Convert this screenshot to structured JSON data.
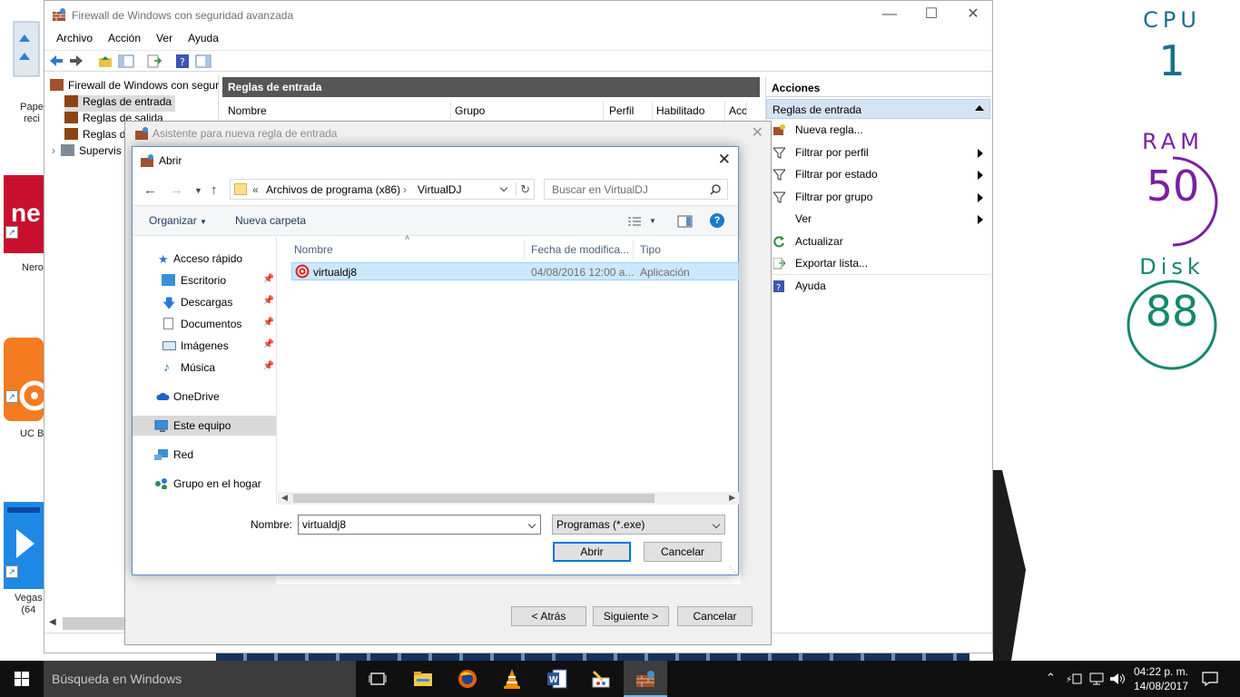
{
  "desktop": {
    "icons": [
      {
        "label": "Pape\nreci"
      },
      {
        "label": "Nero"
      },
      {
        "label": "UC B"
      },
      {
        "label": "Vegas\n(64"
      }
    ],
    "meters": {
      "cpu": {
        "name": "CPU",
        "value": "1",
        "color": "#1a6f8f"
      },
      "ram": {
        "name": "RAM",
        "value": "50",
        "color": "#7a1fa2"
      },
      "disk": {
        "name": "Disk",
        "value": "88",
        "color": "#16876e"
      }
    }
  },
  "firewall": {
    "title": "Firewall de Windows con seguridad avanzada",
    "menu": [
      "Archivo",
      "Acción",
      "Ver",
      "Ayuda"
    ],
    "tree": {
      "root": "Firewall de Windows con segur",
      "items": [
        "Reglas de entrada",
        "Reglas de salida",
        "Reglas d",
        "Supervis"
      ]
    },
    "center_header": "Reglas de entrada",
    "columns": [
      "Nombre",
      "Grupo",
      "Perfil",
      "Habilitado",
      "Acc"
    ],
    "actions": {
      "header": "Acciones",
      "section": "Reglas de entrada",
      "items": [
        {
          "label": "Nueva regla...",
          "icon": "new-rule-icon"
        },
        {
          "label": "Filtrar por perfil",
          "icon": "filter-icon",
          "submenu": true
        },
        {
          "label": "Filtrar por estado",
          "icon": "filter-icon",
          "submenu": true
        },
        {
          "label": "Filtrar por grupo",
          "icon": "filter-icon",
          "submenu": true
        },
        {
          "label": "Ver",
          "icon": "",
          "submenu": true
        },
        {
          "label": "Actualizar",
          "icon": "refresh-icon"
        },
        {
          "label": "Exportar lista...",
          "icon": "export-icon"
        },
        {
          "label": "Ayuda",
          "icon": "help-icon"
        }
      ]
    }
  },
  "wizard": {
    "title": "Asistente para nueva regla de entrada",
    "back_label": "< Atrás",
    "next_label": "Siguiente >",
    "cancel_label": "Cancelar"
  },
  "open_dialog": {
    "title": "Abrir",
    "address": {
      "prefix": "«",
      "crumbs": [
        "Archivos de programa (x86)",
        "VirtualDJ"
      ]
    },
    "search_placeholder": "Buscar en VirtualDJ",
    "organize_label": "Organizar",
    "new_folder_label": "Nueva carpeta",
    "nav": {
      "quick_access": "Acceso rápido",
      "pinned": [
        "Escritorio",
        "Descargas",
        "Documentos",
        "Imágenes",
        "Música"
      ],
      "onedrive": "OneDrive",
      "this_pc": "Este equipo",
      "network": "Red",
      "homegroup": "Grupo en el hogar"
    },
    "columns": {
      "name": "Nombre",
      "date": "Fecha de modifica...",
      "type": "Tipo"
    },
    "files": [
      {
        "name": "virtualdj8",
        "date": "04/08/2016 12:00 a...",
        "type": "Aplicación"
      }
    ],
    "filename_label": "Nombre:",
    "filename_value": "virtualdj8",
    "filetype_value": "Programas (*.exe)",
    "open_label": "Abrir",
    "cancel_label": "Cancelar"
  },
  "taskbar": {
    "search_placeholder": "Búsqueda en Windows",
    "clock_time": "04:22 p. m.",
    "clock_date": "14/08/2017"
  }
}
